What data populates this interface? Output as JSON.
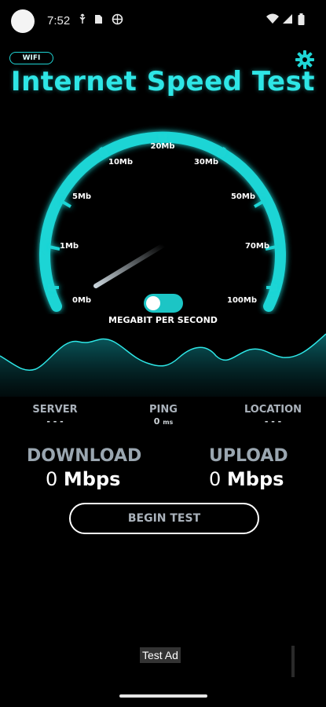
{
  "status_bar": {
    "time": "7:52"
  },
  "app": {
    "badge": "WIFI",
    "title": "Internet Speed Test",
    "gauge": {
      "marks": [
        "0Mb",
        "1Mb",
        "5Mb",
        "10Mb",
        "20Mb",
        "30Mb",
        "50Mb",
        "70Mb",
        "100Mb"
      ],
      "unit_label": "MEGABIT PER SECOND",
      "unit_toggle_on": true
    },
    "info": {
      "server": {
        "label": "SERVER",
        "value": "- - -"
      },
      "ping": {
        "label": "PING",
        "value": "0",
        "unit": "ms"
      },
      "location": {
        "label": "LOCATION",
        "value": "- - -"
      }
    },
    "download": {
      "label": "DOWNLOAD",
      "value": "0",
      "unit": "Mbps"
    },
    "upload": {
      "label": "UPLOAD",
      "value": "0",
      "unit": "Mbps"
    },
    "begin_button": "BEGIN TEST",
    "ad_label": "Test Ad"
  },
  "colors": {
    "accent": "#2ee6e6",
    "background": "#000000",
    "muted": "#9aa6b0"
  },
  "icons": {
    "status": [
      "usb-icon",
      "sim-card-icon",
      "vpn-globe-icon",
      "wifi-icon",
      "signal-icon",
      "battery-icon"
    ],
    "settings": "gear-icon"
  }
}
